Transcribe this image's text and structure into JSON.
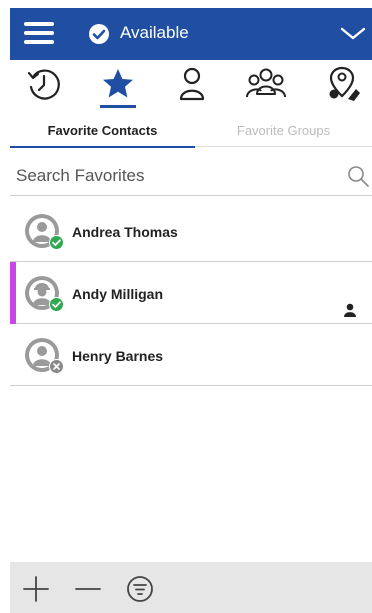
{
  "colors": {
    "brand": "#1f4ea3",
    "accent": "#c946e8",
    "online": "#2fa84f",
    "offline": "#8a8a8a"
  },
  "header": {
    "status_label": "Available",
    "menu_icon": "hamburger-menu-icon",
    "status_icon": "check-circle-icon",
    "dropdown_icon": "chevron-down-icon"
  },
  "icon_tabs": [
    {
      "name": "history-icon",
      "active": false
    },
    {
      "name": "star-icon",
      "active": true
    },
    {
      "name": "contact-icon",
      "active": false
    },
    {
      "name": "group-icon",
      "active": false
    },
    {
      "name": "location-icon",
      "active": false
    }
  ],
  "sub_tabs": {
    "favorite_contacts": "Favorite Contacts",
    "favorite_groups": "Favorite Groups"
  },
  "search": {
    "placeholder": "Search Favorites",
    "value": ""
  },
  "contacts": [
    {
      "name": "Andrea Thomas",
      "status": "online",
      "selected": false
    },
    {
      "name": "Andy Milligan",
      "status": "online",
      "selected": true
    },
    {
      "name": "Henry Barnes",
      "status": "offline",
      "selected": false
    }
  ],
  "toolbar": {
    "add_icon": "plus-icon",
    "remove_icon": "minus-icon",
    "filter_icon": "filter-icon"
  }
}
